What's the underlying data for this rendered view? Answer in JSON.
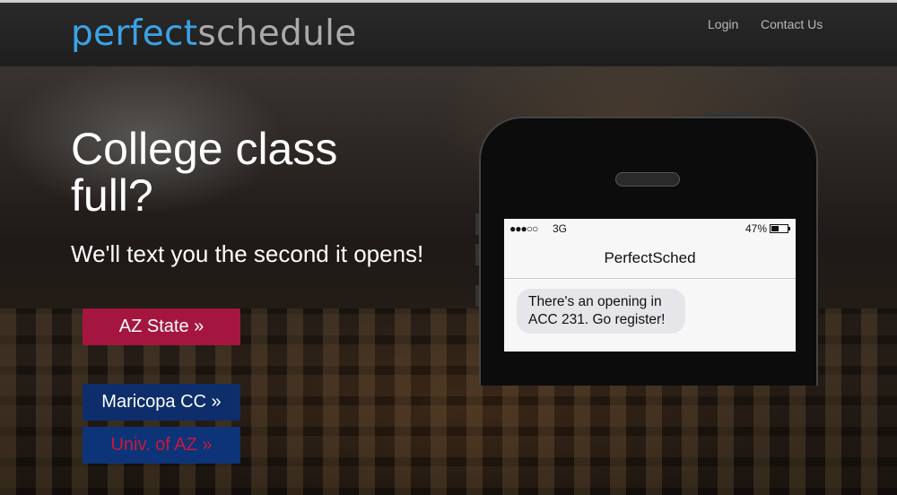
{
  "header": {
    "logo_part1": "perfect",
    "logo_part2": "schedule",
    "nav": {
      "login": "Login",
      "contact": "Contact Us"
    }
  },
  "hero": {
    "headline": "College class full?",
    "subhead": "We'll text you the second it opens!",
    "buttons": {
      "asu": "AZ State »",
      "mcc": "Maricopa CC »",
      "ua": "Univ. of AZ »"
    }
  },
  "phone": {
    "signal": "●●●○○",
    "carrier": "3G",
    "battery": "47%",
    "contact_name": "PerfectSched",
    "message": "There's an opening in ACC 231. Go register!"
  },
  "colors": {
    "brand_blue": "#3aa3e6",
    "asu_maroon": "#a4163f",
    "navy": "#0d2e6b",
    "ua_red": "#c8193c"
  }
}
